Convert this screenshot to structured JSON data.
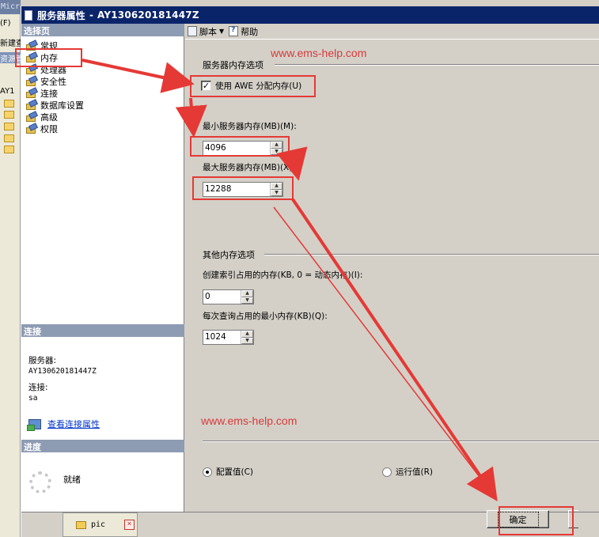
{
  "background_app": {
    "title_fragment": "Micros",
    "menu_fragment": "(F)",
    "toolbar_fragment": "新建查",
    "panel_fragment": "资源管",
    "tree_item": "AY1"
  },
  "dialog": {
    "title": "服务器属性",
    "separator": "-",
    "server_name": "AY130620181447Z"
  },
  "left_panel": {
    "select_page_header": "选择页",
    "pages": [
      "常规",
      "内存",
      "处理器",
      "安全性",
      "连接",
      "数据库设置",
      "高级",
      "权限"
    ],
    "selected_page": "内存",
    "connection_header": "连接",
    "server_label": "服务器:",
    "server_value": "AY130620181447Z",
    "login_label": "连接:",
    "login_value": "sa",
    "view_connection_link": "查看连接属性",
    "progress_header": "进度",
    "progress_status": "就绪"
  },
  "toolbar": {
    "script_label": "脚本",
    "help_label": "帮助"
  },
  "memory_options": {
    "group_title": "服务器内存选项",
    "awe_label": "使用 AWE 分配内存(U)",
    "awe_checked": true,
    "awe_check_glyph": "✓",
    "min_label": "最小服务器内存(MB)(M):",
    "min_value": "4096",
    "max_label": "最大服务器内存(MB)(X):",
    "max_value": "12288"
  },
  "other_memory": {
    "group_title": "其他内存选项",
    "index_label": "创建索引占用的内存(KB, 0 = 动态内存)(I):",
    "index_value": "0",
    "query_label": "每次查询占用的最小内存(KB)(Q):",
    "query_value": "1024"
  },
  "value_mode": {
    "configured_label": "配置值(C)",
    "running_label": "运行值(R)",
    "selected": "configured"
  },
  "buttons": {
    "ok_label": "确定"
  },
  "taskbar": {
    "tab_label": "pic",
    "close_glyph": "×"
  },
  "watermarks": [
    "www.ems-help.com",
    "www.ems-help.com"
  ],
  "colors": {
    "annotation_red": "#e53935",
    "titlebar_blue": "#0a246a",
    "section_header": "#8d9bb3",
    "watermark_red": "#d83a3a"
  }
}
